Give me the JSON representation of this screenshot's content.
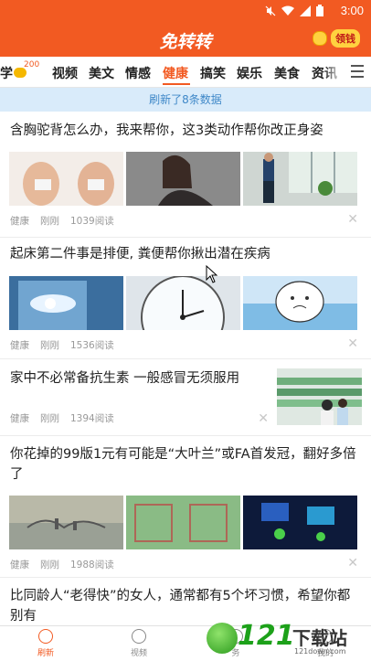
{
  "status_bar": {
    "time": "3:00",
    "icons": [
      "mute-icon",
      "wifi-icon",
      "signal-icon",
      "battery-icon"
    ]
  },
  "header": {
    "title": "免转转",
    "redpack_label": "领钱"
  },
  "tabs": {
    "partial_label": "学",
    "coin_badge": "200",
    "items": [
      "视频",
      "美文",
      "情感",
      "健康",
      "搞笑",
      "娱乐",
      "美食",
      "资讯"
    ],
    "active": "健康"
  },
  "refresh_notice": "刷新了8条数据",
  "articles": [
    {
      "title": "含胸驼背怎么办，我来帮你，这3类动作帮你改正身姿",
      "category": "健康",
      "time": "刚刚",
      "reads": "1039阅读"
    },
    {
      "title": "起床第二件事是排便, 粪便帮你揪出潜在疾病",
      "category": "健康",
      "time": "刚刚",
      "reads": "1536阅读"
    },
    {
      "title": "家中不必常备抗生素 一般感冒无须服用",
      "category": "健康",
      "time": "刚刚",
      "reads": "1394阅读"
    },
    {
      "title": "你花掉的99版1元有可能是“大叶兰”或FA首发冠，翻好多倍了",
      "category": "健康",
      "time": "刚刚",
      "reads": "1988阅读"
    },
    {
      "title": "比同龄人“老得快”的女人，通常都有5个坏习惯，希望你都别有"
    }
  ],
  "bottom_nav": {
    "items": [
      "刷新",
      "视频",
      "务",
      "我的"
    ],
    "active": "刷新"
  },
  "watermark": {
    "number": "121",
    "text": "下载站",
    "url": "121down.com"
  },
  "colors": {
    "brand": "#f25a22",
    "refresh_bg": "#d9ebfa",
    "refresh_text": "#3f88c8"
  }
}
